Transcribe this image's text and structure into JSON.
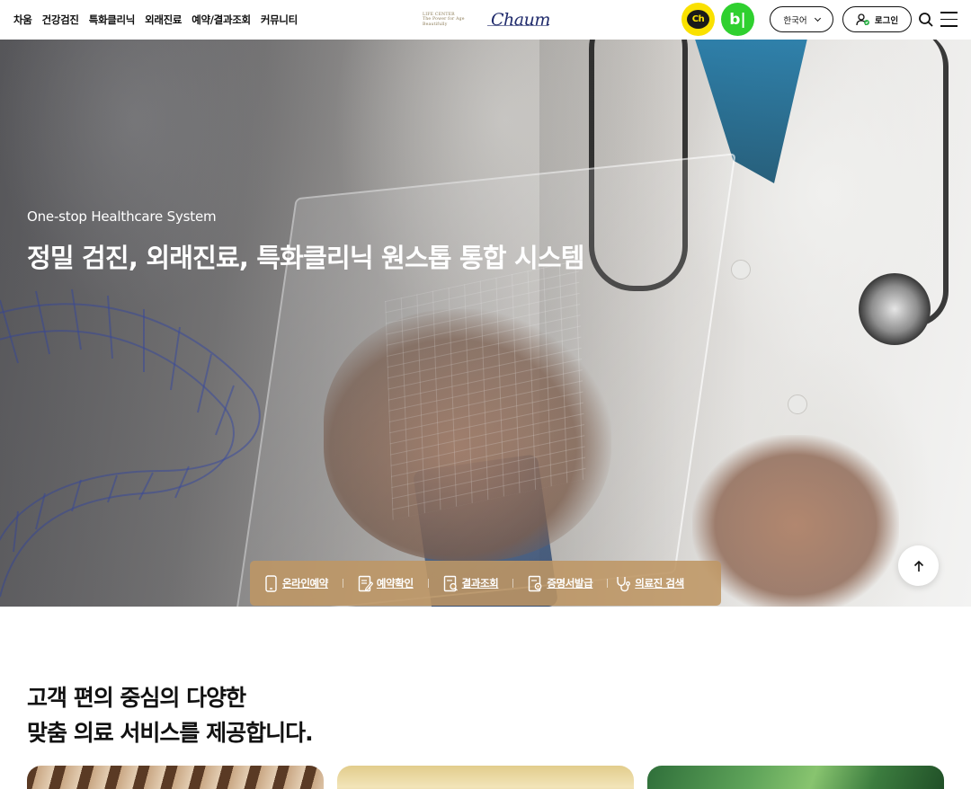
{
  "nav": {
    "items": [
      {
        "label": "차움"
      },
      {
        "label": "건강검진"
      },
      {
        "label": "특화클리닉"
      },
      {
        "label": "외래진료"
      },
      {
        "label": "예약/결과조회"
      },
      {
        "label": "커뮤니티"
      }
    ]
  },
  "logo": {
    "sub_line1": "LIFE CENTER",
    "sub_line2": "The Power for Age Beautifully",
    "main": "Chaum"
  },
  "header": {
    "kakao_label": "Ch",
    "blog_label": "b|",
    "language_label": "한국어",
    "login_label": "로그인"
  },
  "hero": {
    "subtitle": "One-stop Healthcare System",
    "title": "정밀 검진, 외래진료, 특화클리닉 원스톱 통합 시스템"
  },
  "quick_menu": {
    "items": [
      {
        "label": "온라인예약",
        "icon": "mobile-phone-icon"
      },
      {
        "label": "예약확인",
        "icon": "document-edit-icon"
      },
      {
        "label": "결과조회",
        "icon": "document-search-icon"
      },
      {
        "label": "증명서발급",
        "icon": "certificate-icon"
      },
      {
        "label": "의료진 검색",
        "icon": "stethoscope-icon"
      }
    ],
    "background": "#be9664"
  },
  "section": {
    "title_line1": "고객 편의 중심의 다양한",
    "title_line2": "맞춤 의료 서비스를 제공합니다."
  },
  "colors": {
    "kakao": "#fae100",
    "blog": "#2fd02f",
    "text": "#111111"
  }
}
